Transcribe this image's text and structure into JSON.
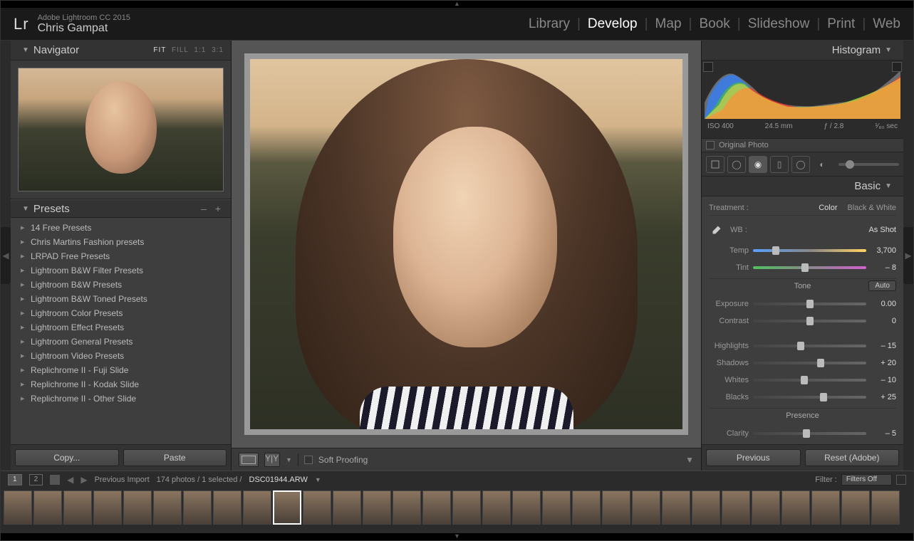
{
  "app": {
    "version": "Adobe Lightroom CC 2015",
    "user": "Chris Gampat",
    "logo": "Lr"
  },
  "modules": [
    "Library",
    "Develop",
    "Map",
    "Book",
    "Slideshow",
    "Print",
    "Web"
  ],
  "activeModule": "Develop",
  "navigator": {
    "title": "Navigator",
    "zoom": {
      "fit": "FIT",
      "fill": "FILL",
      "one": "1:1",
      "three": "3:1"
    }
  },
  "presets": {
    "title": "Presets",
    "items": [
      "14 Free Presets",
      "Chris Martins Fashion presets",
      "LRPAD Free Presets",
      "Lightroom B&W Filter Presets",
      "Lightroom B&W Presets",
      "Lightroom B&W Toned Presets",
      "Lightroom Color Presets",
      "Lightroom Effect Presets",
      "Lightroom General Presets",
      "Lightroom Video Presets",
      "Replichrome II - Fuji Slide",
      "Replichrome II - Kodak Slide",
      "Replichrome II - Other Slide"
    ]
  },
  "buttons": {
    "copy": "Copy...",
    "paste": "Paste",
    "previous": "Previous",
    "reset": "Reset (Adobe)"
  },
  "softproof": "Soft Proofing",
  "histogram": {
    "title": "Histogram",
    "iso": "ISO 400",
    "focal": "24.5 mm",
    "aperture": "ƒ / 2.8",
    "shutter": "¹⁄₈₀ sec",
    "original": "Original Photo"
  },
  "basic": {
    "title": "Basic",
    "treatment": {
      "label": "Treatment :",
      "color": "Color",
      "bw": "Black & White"
    },
    "wb": {
      "label": "WB :",
      "mode": "As Shot"
    },
    "temp": {
      "label": "Temp",
      "value": "3,700",
      "pos": 20
    },
    "tint": {
      "label": "Tint",
      "value": "– 8",
      "pos": 46
    },
    "tone": "Tone",
    "auto": "Auto",
    "exposure": {
      "label": "Exposure",
      "value": "0.00",
      "pos": 50
    },
    "contrast": {
      "label": "Contrast",
      "value": "0",
      "pos": 50
    },
    "highlights": {
      "label": "Highlights",
      "value": "– 15",
      "pos": 42
    },
    "shadows": {
      "label": "Shadows",
      "value": "+ 20",
      "pos": 60
    },
    "whites": {
      "label": "Whites",
      "value": "– 10",
      "pos": 45
    },
    "blacks": {
      "label": "Blacks",
      "value": "+ 25",
      "pos": 62
    },
    "presence": "Presence",
    "clarity": {
      "label": "Clarity",
      "value": "– 5",
      "pos": 47
    }
  },
  "filmstrip": {
    "source": "Previous Import",
    "count": "174 photos / 1 selected /",
    "filename": "DSC01944.ARW",
    "filter": {
      "label": "Filter :",
      "value": "Filters Off"
    },
    "views": {
      "one": "1",
      "two": "2"
    }
  }
}
